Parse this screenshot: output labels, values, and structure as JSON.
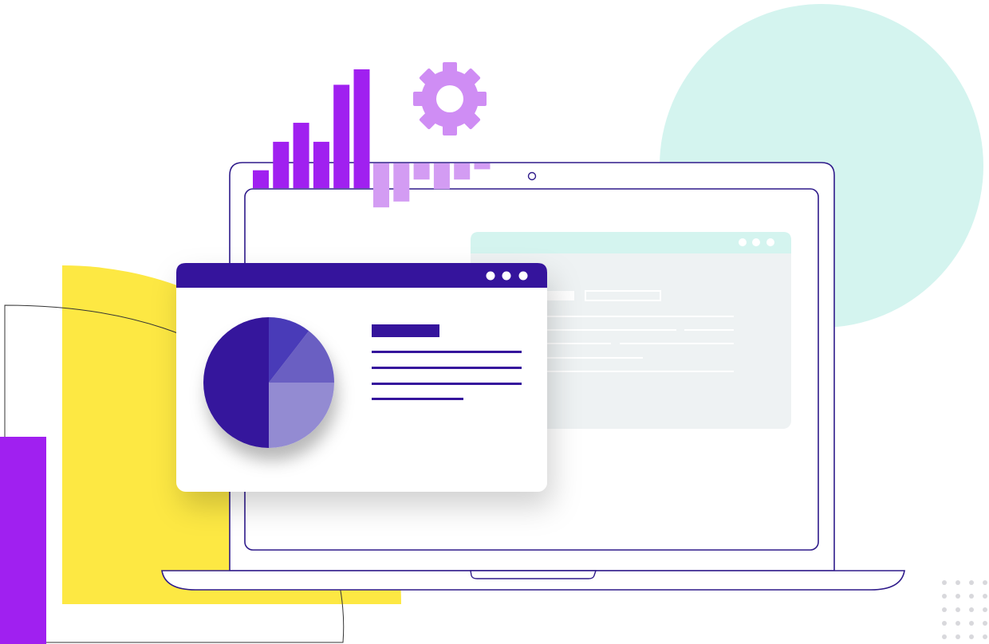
{
  "colors": {
    "deep_purple": "#35149c",
    "violet": "#a020f0",
    "light_violet": "#d39cf3",
    "gear": "#cf8df4",
    "mint": "#d4f4ef",
    "yellow": "#fde843",
    "outline": "#2e1a8a",
    "panel_bg": "#eef2f3",
    "pie_slice_light": "#938bd2",
    "pie_slice_mid": "#6b5fc2",
    "pie_slice_accent": "#4a3bb8"
  },
  "icons": {
    "gear": "gear-icon",
    "window_dots": "window-control-dots-icon",
    "webcam": "webcam-icon"
  },
  "bar_graphic": {
    "upward_bar_levels": [
      0.15,
      0.39,
      0.55,
      0.39,
      0.87,
      1.0
    ],
    "downward_bar_levels": [
      0.6,
      0.52,
      0.22,
      0.35,
      0.22,
      0.08
    ]
  },
  "pie_graphic": {
    "slices": [
      {
        "fraction": 0.5,
        "color": "#35149c"
      },
      {
        "fraction": 0.105,
        "color": "#4a3bb8"
      },
      {
        "fraction": 0.145,
        "color": "#6b5fc2"
      },
      {
        "fraction": 0.25,
        "color": "#938bd2"
      }
    ]
  }
}
